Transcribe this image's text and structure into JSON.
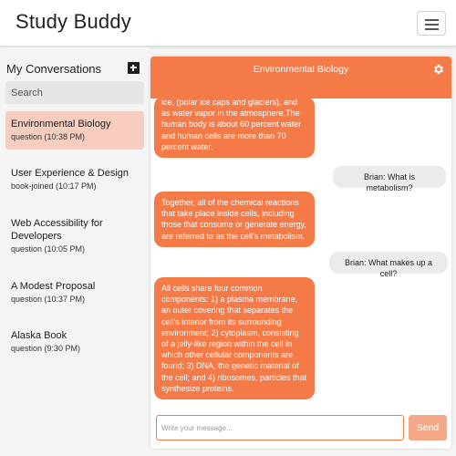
{
  "app": {
    "title": "Study Buddy"
  },
  "sidebar": {
    "title": "My Conversations",
    "search_placeholder": "Search",
    "conversations": [
      {
        "title": "Environmental Biology",
        "subtitle": "question (10:38 PM)",
        "active": true
      },
      {
        "title": "User Experience & Design",
        "subtitle": "book-joined (10:17 PM)",
        "active": false
      },
      {
        "title": "Web Accessibility for Developers",
        "subtitle": "question (10:05 PM)",
        "active": false
      },
      {
        "title": "A Modest Proposal",
        "subtitle": "question (10:37 PM)",
        "active": false
      },
      {
        "title": "Alaska Book",
        "subtitle": "question (9:30 PM)",
        "active": false
      }
    ]
  },
  "chat": {
    "title": "Environmental Biology",
    "messages": [
      {
        "from": "bot",
        "text": "ice, (polar ice caps and glaciers), and as water vapor in the atmosphere.The human body is about 60 percent water and human cells are more than 70 percent water."
      },
      {
        "from": "user",
        "text": "Brian: What is metabolism?"
      },
      {
        "from": "bot",
        "text": "Together, all of the chemical reactions that take place inside cells, including those that consume or generate energy, are referred to as the cell's metabolism."
      },
      {
        "from": "user",
        "text": "Brian: What makes up a cell?"
      },
      {
        "from": "bot",
        "text": "All cells share four common components: 1) a plasma membrane, an outer covering that separates the cell's interior from its surrounding environment; 2) cytoplasm, consisting of a jelly-like region within the cell in which other cellular components are found; 3) DNA, the genetic material of the cell; and 4) ribosomes, particles that synthesize proteins."
      }
    ],
    "input_placeholder": "Write your message...",
    "send_label": "Send"
  },
  "colors": {
    "accent": "#f47a48",
    "active_item": "#f6cdbe",
    "send_button": "#f5a887"
  },
  "icons": {
    "menu": "hamburger-icon",
    "add": "add-conversation-icon",
    "settings": "gear-icon"
  }
}
